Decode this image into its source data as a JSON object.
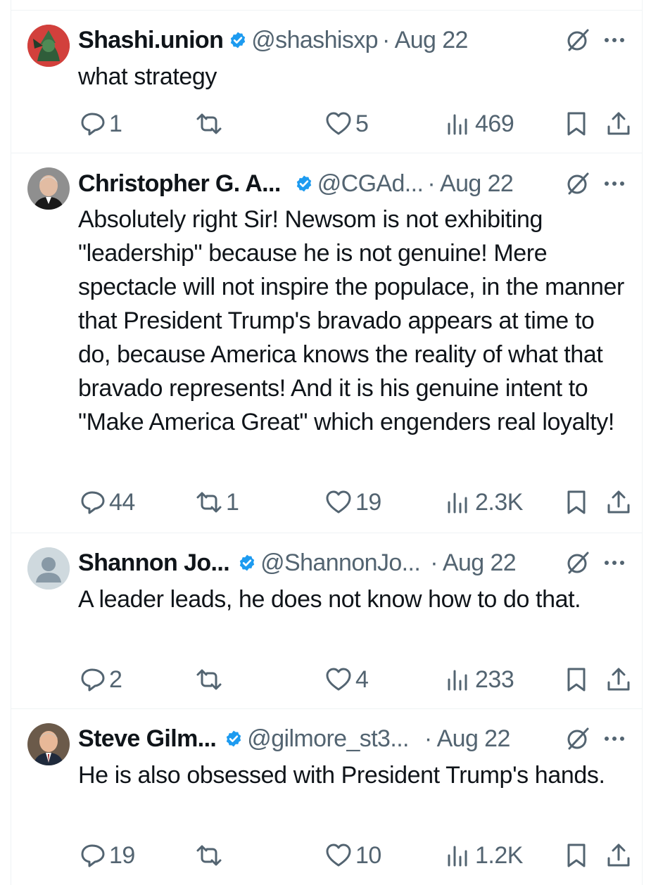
{
  "tweets": [
    {
      "name": "Shashi.union",
      "handle": "@shashisxp",
      "date": "· Aug 22",
      "text": "what strategy",
      "replies": "1",
      "reposts": "",
      "likes": "5",
      "views": "469"
    },
    {
      "name": "Christopher G. A...",
      "handle": "@CGAd...",
      "date": "· Aug 22",
      "text": "Absolutely right Sir! Newsom is not exhibiting \"leadership\" because he is not genuine! Mere spectacle will not inspire the populace, in the manner that President Trump's bravado appears at time to do, because America knows the reality of what that bravado represents! And it is his genuine intent to \"Make America Great\" which engenders real loyalty!",
      "replies": "44",
      "reposts": "1",
      "likes": "19",
      "views": "2.3K"
    },
    {
      "name": "Shannon Jo...",
      "handle": "@ShannonJo...",
      "date": "· Aug 22",
      "text": "A leader leads, he does not know how to do that.",
      "replies": "2",
      "reposts": "",
      "likes": "4",
      "views": "233"
    },
    {
      "name": "Steve Gilm...",
      "handle": "@gilmore_st3...",
      "date": "· Aug 22",
      "text": "He is also obsessed with President Trump's hands.",
      "replies": "19",
      "reposts": "",
      "likes": "10",
      "views": "1.2K"
    }
  ],
  "colors": {
    "text": "#0f1419",
    "muted": "#536471",
    "verified": "#1d9bf0",
    "border": "#eff3f4"
  }
}
